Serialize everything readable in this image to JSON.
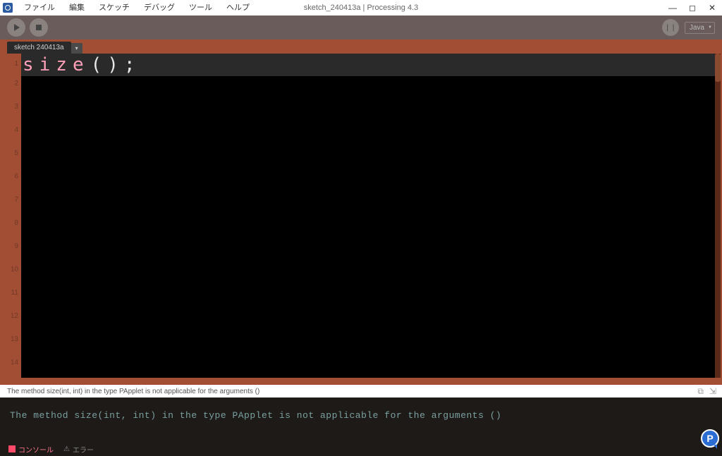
{
  "menus": {
    "file": "ファイル",
    "edit": "編集",
    "sketch": "スケッチ",
    "debug": "デバッグ",
    "tools": "ツール",
    "help": "ヘルプ"
  },
  "window": {
    "title": "sketch_240413a | Processing 4.3"
  },
  "toolbar": {
    "debug_label": "❘❘",
    "mode": "Java"
  },
  "tab": {
    "name": "sketch 240413a",
    "dropdown": "▾"
  },
  "editor": {
    "line_numbers": [
      "1",
      "2",
      "3",
      "4",
      "5",
      "6",
      "7",
      "8",
      "9",
      "10",
      "11",
      "12",
      "13",
      "14"
    ],
    "code": {
      "func": "size",
      "rest": "();"
    }
  },
  "error_bar": {
    "message": "The method size(int, int) in the type PApplet is not applicable for the arguments ()"
  },
  "console": {
    "message": "The method size(int, int) in the type PApplet is not applicable for the arguments ()"
  },
  "bottom_tabs": {
    "console": "コンソール",
    "errors": "エラー"
  },
  "help_bubble": "P"
}
